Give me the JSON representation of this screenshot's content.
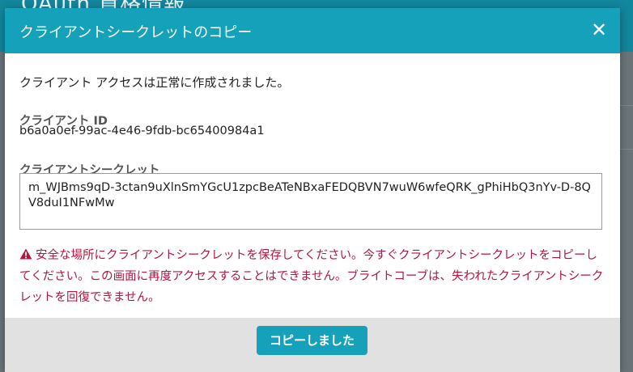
{
  "background": {
    "page_title": "OAuth 資格情報"
  },
  "modal": {
    "title": "クライアントシークレットのコピー",
    "close_glyph": "✕",
    "success_message": "クライアント アクセスは正常に作成されました。",
    "client_id_label": "クライアント ID",
    "client_id_value": "b6a0a0ef-99ac-4e46-9fdb-bc65400984a1",
    "secret_label": "クライアントシークレット",
    "secret_value": "m_WJBms9qD-3ctan9uXlnSmYGcU1zpcBeATeNBxaFEDQBVN7wuW6wfeQRK_gPhiHbQ3nYv-D-8QV8duI1NFwMw",
    "warning_text": "安全な場所にクライアントシークレットを保存してください。今すぐクライアントシークレットをコピーしてください。この画面に再度アクセスすることはできません。ブライトコーブは、失われたクライアントシークレットを回復できません。",
    "warning_icon": "warning-triangle",
    "copied_button_label": "コピーしました"
  },
  "colors": {
    "header": "#15a1b9",
    "warning": "#b5153f",
    "footer": "#e1e1e1"
  }
}
